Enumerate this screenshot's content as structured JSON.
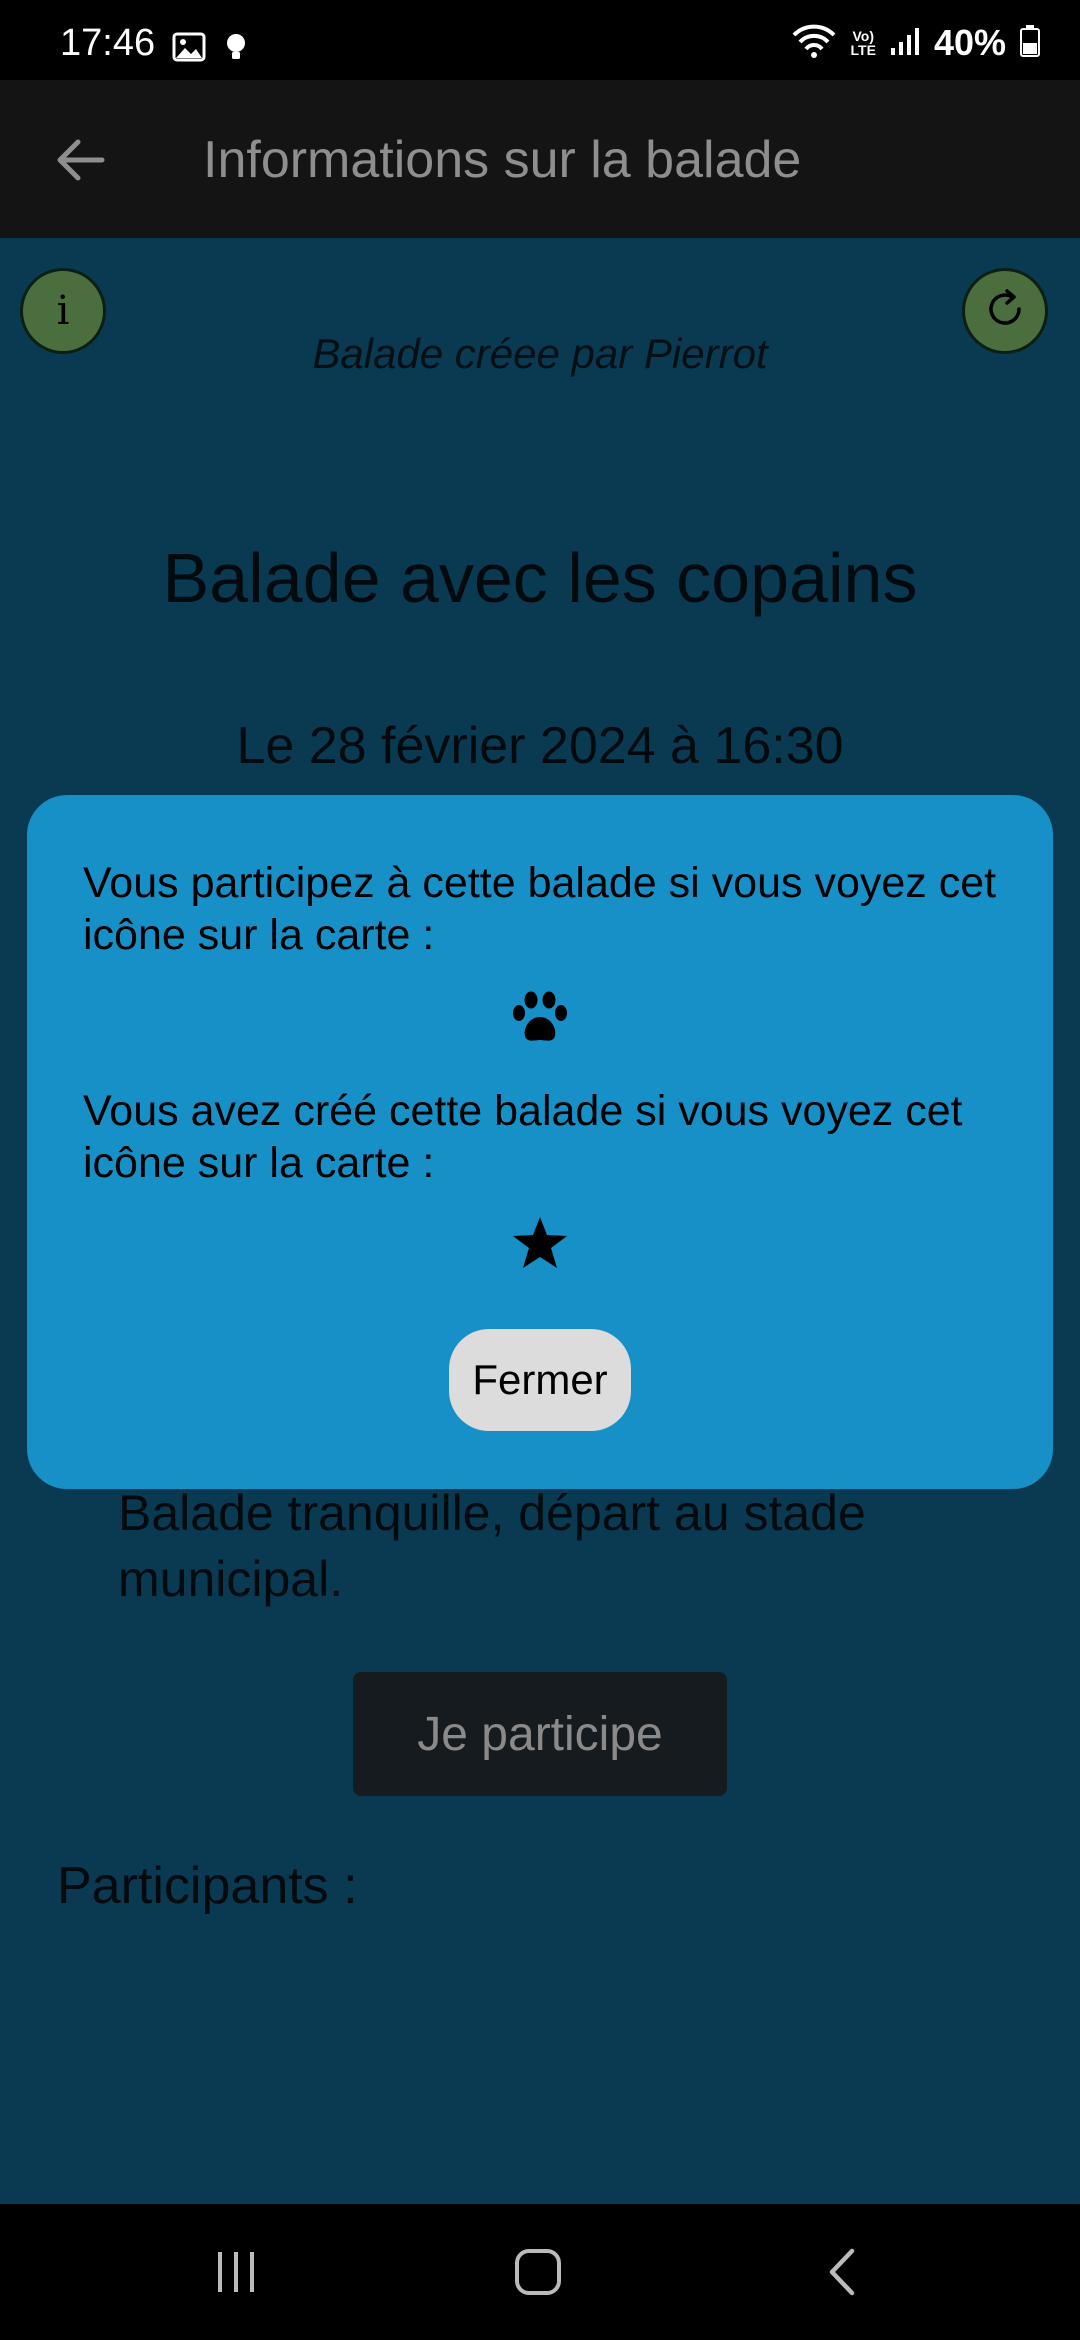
{
  "status_bar": {
    "time": "17:46",
    "network": "LTE",
    "volte": "Vo)",
    "battery": "40%"
  },
  "app_bar": {
    "title": "Informations sur la balade"
  },
  "walk": {
    "creator": "Balade créee par Pierrot",
    "title": "Balade avec les copains",
    "date": "Le 28 février 2024 à 16:30",
    "description": "Balade tranquille, départ au stade municipal.",
    "join_label": "Je participe",
    "participants_label": "Participants :"
  },
  "dialog": {
    "participate_text": "Vous participez à cette balade si vous voyez cet icône sur la carte :",
    "participate_icon": "paw-icon",
    "created_text": "Vous avez créé cette balade si vous voyez cet icône sur la carte :",
    "created_icon": "star-icon",
    "close_label": "Fermer"
  },
  "colors": {
    "background": "#0a3a52",
    "dialog": "#1790c8",
    "round_button": "#4a6e3d",
    "app_bar": "#141414"
  }
}
